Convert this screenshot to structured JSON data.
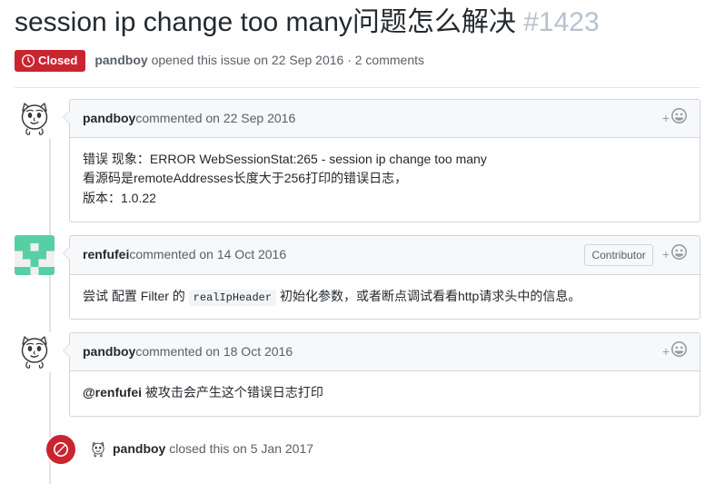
{
  "issue": {
    "title": "session ip change too many问题怎么解决",
    "number": "#1423",
    "state_label": "Closed",
    "state_icon": "issue-closed-icon",
    "state_color": "#cb2431",
    "meta_author": "pandboy",
    "meta_text": " opened this issue on 22 Sep 2016 · 2 comments"
  },
  "comments": [
    {
      "author": "pandboy",
      "meta": " commented on 22 Sep 2016",
      "avatar": "pandboy-face-avatar",
      "contributor_badge": null,
      "reaction_plus": "+",
      "reaction_icon": "smiley-icon",
      "body_lines": [
        "错误 现象：ERROR WebSessionStat:265 - session ip change too many",
        "看源码是remoteAddresses长度大于256打印的错误日志，",
        "版本：1.0.22"
      ]
    },
    {
      "author": "renfufei",
      "meta": " commented on 14 Oct 2016",
      "avatar": "renfufei-identicon-avatar",
      "contributor_badge": "Contributor",
      "reaction_plus": "+",
      "reaction_icon": "smiley-icon",
      "body_parts": {
        "before": "尝试 配置 Filter 的 ",
        "code": "realIpHeader",
        "after": " 初始化参数，或者断点调试看看http请求头中的信息。"
      }
    },
    {
      "author": "pandboy",
      "meta": " commented on 18 Oct 2016",
      "avatar": "pandboy-face-avatar",
      "contributor_badge": null,
      "reaction_plus": "+",
      "reaction_icon": "smiley-icon",
      "body_parts": {
        "mention": "@renfufei",
        "after": " 被攻击会产生这个错误日志打印"
      }
    }
  ],
  "closed_event": {
    "icon": "circle-slash-icon",
    "icon_color": "#cb2431",
    "avatar": "pandboy-face-avatar",
    "author": "pandboy",
    "text": " closed this on 5 Jan 2017"
  }
}
